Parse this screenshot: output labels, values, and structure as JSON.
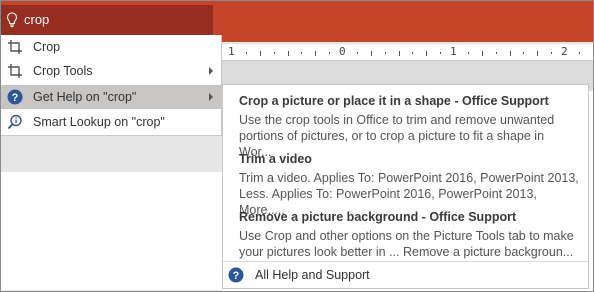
{
  "search": {
    "value": "crop"
  },
  "ruler": {
    "labels": [
      "1",
      "0",
      "1",
      "2"
    ]
  },
  "menu": {
    "items": [
      {
        "label": "Crop",
        "icon": "crop-icon",
        "has_submenu": false
      },
      {
        "label": "Crop Tools",
        "icon": "crop-icon",
        "has_submenu": true
      },
      {
        "label": "Get Help on \"crop\"",
        "icon": "help-circle-icon",
        "has_submenu": true,
        "active": true
      },
      {
        "label": "Smart Lookup on \"crop\"",
        "icon": "smart-lookup-icon",
        "has_submenu": false
      }
    ]
  },
  "help": {
    "results": [
      {
        "title": "Crop a picture or place it in a shape - Office Support",
        "desc": "Use the crop tools in Office to trim and remove unwanted portions of pictures, or to crop a picture to fit a shape in Wor..."
      },
      {
        "title": "Trim a video",
        "desc": "Trim a video. Applies To: PowerPoint 2016, PowerPoint 2013, Less. Applies To: PowerPoint 2016, PowerPoint 2013, More....."
      },
      {
        "title": "Remove a picture background - Office Support",
        "desc": "Use Crop and other options on the Picture Tools tab to make your pictures look better in ... Remove a picture backgroun..."
      }
    ],
    "footer_label": "All Help and Support"
  },
  "colors": {
    "ribbon": "#c4452a",
    "search_bg": "#962d1e",
    "active_item": "#c8c6c4",
    "help_icon": "#2b579a"
  }
}
